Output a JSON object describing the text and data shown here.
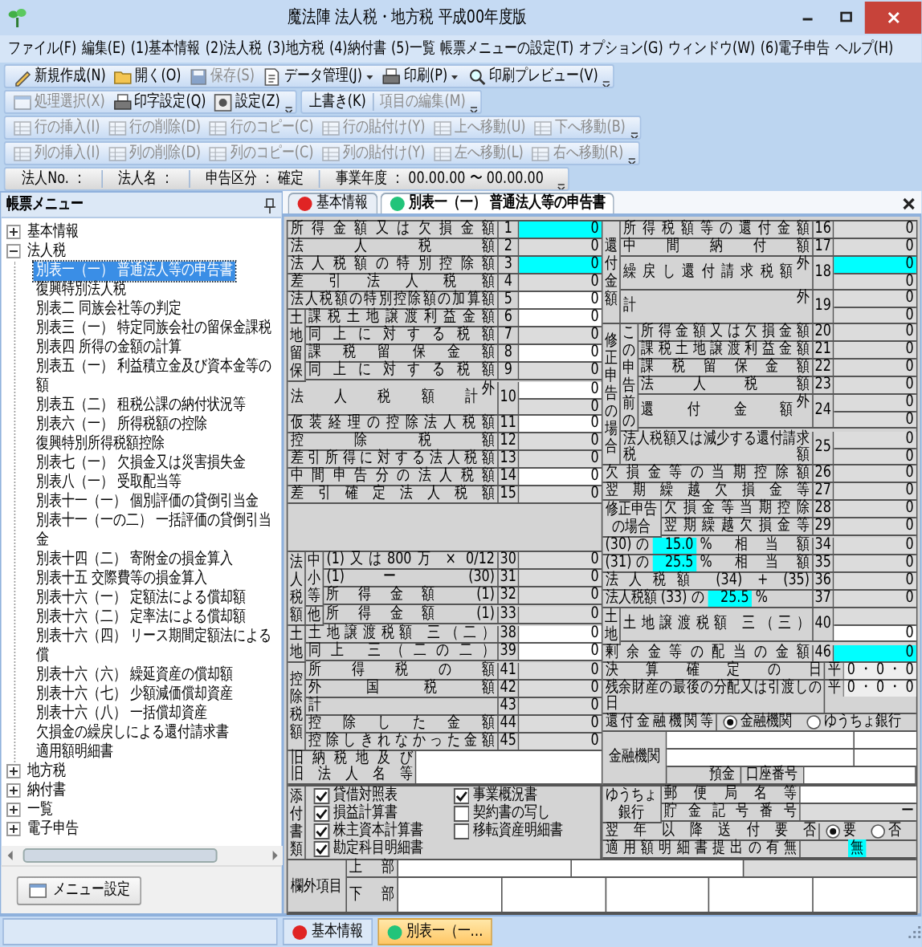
{
  "window": {
    "title": "魔法陣 法人税・地方税 平成00年度版"
  },
  "menu": [
    "ファイル(F)",
    "編集(E)",
    "(1)基本情報",
    "(2)法人税",
    "(3)地方税",
    "(4)納付書",
    "(5)一覧",
    "帳票メニューの設定(T)",
    "オプション(G)",
    "ウィンドウ(W)",
    "(6)電子申告",
    "ヘルプ(H)"
  ],
  "toolbar_rows": [
    [
      [
        {
          "label": "新規作成(N)",
          "kind": "icon-button",
          "disabled": false,
          "dropdown": false
        },
        {
          "label": "開く(O)",
          "kind": "icon-button",
          "disabled": false,
          "dropdown": false
        },
        {
          "label": "保存(S)",
          "kind": "icon-button",
          "disabled": true,
          "dropdown": false
        },
        {
          "label": "データ管理(J)",
          "kind": "icon-button",
          "disabled": false,
          "dropdown": true
        },
        {
          "label": "印刷(P)",
          "kind": "icon-button",
          "disabled": false,
          "dropdown": true
        },
        {
          "label": "印刷プレビュー(V)",
          "kind": "icon-button",
          "disabled": false,
          "dropdown": false
        }
      ]
    ],
    [
      [
        {
          "label": "処理選択(X)",
          "kind": "icon-button",
          "disabled": true,
          "dropdown": false
        },
        {
          "label": "印字設定(Q)",
          "kind": "icon-button",
          "disabled": false,
          "dropdown": false
        },
        {
          "label": "設定(Z)",
          "kind": "icon-button",
          "disabled": false,
          "dropdown": false
        }
      ],
      [
        {
          "label": "上書き(K)",
          "kind": "text-button",
          "disabled": false,
          "dropdown": false
        },
        {
          "label": "項目の編集(M)",
          "kind": "text-button",
          "disabled": true,
          "dropdown": false
        }
      ]
    ],
    [
      [
        {
          "label": "行の挿入(I)",
          "kind": "icon-button",
          "disabled": true,
          "dropdown": false
        },
        {
          "label": "行の削除(D)",
          "kind": "icon-button",
          "disabled": true,
          "dropdown": false
        },
        {
          "label": "行のコピー(C)",
          "kind": "icon-button",
          "disabled": true,
          "dropdown": false
        },
        {
          "label": "行の貼付け(Y)",
          "kind": "icon-button",
          "disabled": true,
          "dropdown": false
        },
        {
          "label": "上へ移動(U)",
          "kind": "icon-button",
          "disabled": true,
          "dropdown": false
        },
        {
          "label": "下へ移動(B)",
          "kind": "icon-button",
          "disabled": true,
          "dropdown": false
        }
      ]
    ],
    [
      [
        {
          "label": "列の挿入(I)",
          "kind": "icon-button",
          "disabled": true,
          "dropdown": false
        },
        {
          "label": "列の削除(D)",
          "kind": "icon-button",
          "disabled": true,
          "dropdown": false
        },
        {
          "label": "列のコピー(C)",
          "kind": "icon-button",
          "disabled": true,
          "dropdown": false
        },
        {
          "label": "列の貼付け(Y)",
          "kind": "icon-button",
          "disabled": true,
          "dropdown": false
        },
        {
          "label": "左へ移動(L)",
          "kind": "icon-button",
          "disabled": true,
          "dropdown": false
        },
        {
          "label": "右へ移動(R)",
          "kind": "icon-button",
          "disabled": true,
          "dropdown": false
        }
      ]
    ]
  ],
  "info_bar": [
    "法人No. ：",
    "法人名 ：",
    "申告区分 ： 確定",
    "事業年度 ： 00.00.00 〜 00.00.00"
  ],
  "sidebar": {
    "title": "帳票メニュー",
    "items": [
      {
        "label": "基本情報",
        "expanded": false,
        "selected": false
      },
      {
        "label": "法人税",
        "expanded": true,
        "selected": false,
        "children": [
          {
            "label": "別表一（一） 普通法人等の申告書",
            "selected": true
          },
          {
            "label": "復興特別法人税",
            "selected": false
          },
          {
            "label": "別表二 同族会社等の判定",
            "selected": false
          },
          {
            "label": "別表三（一） 特定同族会社の留保金課税",
            "selected": false
          },
          {
            "label": "別表四 所得の金額の計算",
            "selected": false
          },
          {
            "label": "別表五（一） 利益積立金及び資本金等の額",
            "selected": false
          },
          {
            "label": "別表五（二） 租税公課の納付状況等",
            "selected": false
          },
          {
            "label": "別表六（一） 所得税額の控除",
            "selected": false
          },
          {
            "label": "復興特別所得税額控除",
            "selected": false
          },
          {
            "label": "別表七（一） 欠損金又は災害損失金",
            "selected": false
          },
          {
            "label": "別表八（一） 受取配当等",
            "selected": false
          },
          {
            "label": "別表十一（一） 個別評価の貸倒引当金",
            "selected": false
          },
          {
            "label": "別表十一（一の二） 一括評価の貸倒引当金",
            "selected": false
          },
          {
            "label": "別表十四（二） 寄附金の損金算入",
            "selected": false
          },
          {
            "label": "別表十五 交際費等の損金算入",
            "selected": false
          },
          {
            "label": "別表十六（一） 定額法による償却額",
            "selected": false
          },
          {
            "label": "別表十六（二） 定率法による償却額",
            "selected": false
          },
          {
            "label": "別表十六（四） リース期間定額法による償",
            "selected": false
          },
          {
            "label": "別表十六（六） 繰延資産の償却額",
            "selected": false
          },
          {
            "label": "別表十六（七） 少額減価償却資産",
            "selected": false
          },
          {
            "label": "別表十六（八） 一括償却資産",
            "selected": false
          },
          {
            "label": "欠損金の繰戻しによる還付請求書",
            "selected": false
          },
          {
            "label": "適用額明細書",
            "selected": false
          }
        ]
      },
      {
        "label": "地方税",
        "expanded": false,
        "selected": false
      },
      {
        "label": "納付書",
        "expanded": false,
        "selected": false
      },
      {
        "label": "一覧",
        "expanded": false,
        "selected": false
      },
      {
        "label": "電子申告",
        "expanded": false,
        "selected": false
      }
    ],
    "button": "メニュー設定"
  },
  "doc_tabs": [
    {
      "label": "基本情報",
      "color": "#e02424",
      "selected": false
    },
    {
      "label": "別表一（一） 普通法人等の申告書",
      "color": "#22c47a",
      "selected": true
    }
  ],
  "form": {
    "left": [
      {
        "kind": "plain",
        "rows": [
          {
            "kind": "amount",
            "label": "所得金額又は欠損金額",
            "no": "1",
            "cells": [
              {
                "kind": "highlight",
                "text": "0"
              }
            ]
          },
          {
            "kind": "amount",
            "label": "法人税額",
            "no": "2",
            "cells": [
              {
                "kind": "calc",
                "text": "0"
              }
            ]
          },
          {
            "kind": "amount",
            "label": "法人税額の特別控除額",
            "no": "3",
            "cells": [
              {
                "kind": "highlight",
                "text": "0"
              }
            ]
          },
          {
            "kind": "amount",
            "label": "差引法人税額",
            "no": "4",
            "cells": [
              {
                "kind": "calc",
                "text": "0"
              }
            ]
          },
          {
            "kind": "amount",
            "label": "法人税額の特別控除額の加算額",
            "no": "5",
            "cells": [
              {
                "kind": "input",
                "text": "0"
              }
            ]
          }
        ]
      },
      {
        "kind": "side",
        "side": "土地留保",
        "rows": [
          {
            "kind": "amount",
            "label": "課税土地譲渡利益金額",
            "no": "6",
            "cells": [
              {
                "kind": "input",
                "text": "0"
              }
            ]
          },
          {
            "kind": "amount",
            "label": "同上に対する税額",
            "no": "7",
            "cells": [
              {
                "kind": "calc",
                "text": "0"
              }
            ]
          },
          {
            "kind": "amount",
            "label": "課税留保金額",
            "no": "8",
            "cells": [
              {
                "kind": "input",
                "text": "0"
              }
            ]
          },
          {
            "kind": "amount",
            "label": "同上に対する税額",
            "no": "9",
            "cells": [
              {
                "kind": "calc",
                "text": "0"
              }
            ]
          }
        ]
      },
      {
        "kind": "plain",
        "rows": [
          {
            "kind": "amount",
            "label": "法人税額計",
            "ext": "外",
            "no": "10",
            "cells": [
              {
                "kind": "input",
                "text": "0"
              },
              {
                "kind": "calc",
                "text": "0"
              }
            ]
          },
          {
            "kind": "amount",
            "label": "仮装経理の控除法人税額",
            "no": "11",
            "cells": [
              {
                "kind": "input",
                "text": "0"
              }
            ]
          },
          {
            "kind": "amount",
            "label": "控除税額",
            "no": "12",
            "cells": [
              {
                "kind": "calc",
                "text": "0"
              }
            ]
          },
          {
            "kind": "amount",
            "label": "差引所得に対する法人税額",
            "no": "13",
            "cells": [
              {
                "kind": "calc",
                "text": "0"
              }
            ]
          },
          {
            "kind": "amount",
            "label": "中間申告分の法人税額",
            "no": "14",
            "cells": [
              {
                "kind": "input",
                "text": "0"
              }
            ]
          },
          {
            "kind": "amount",
            "label": "差引確定法人税額",
            "no": "15",
            "cells": [
              {
                "kind": "calc",
                "text": "0"
              }
            ]
          }
        ]
      },
      {
        "kind": "blank"
      },
      {
        "kind": "side",
        "side": "法人税額",
        "groups": [
          {
            "kind": "side",
            "side": "中小等",
            "rows": [
              {
                "kind": "amount",
                "label": "(1)又は800万 × 0/12",
                "no": "30",
                "cells": [
                  {
                    "kind": "calc",
                    "text": "0"
                  }
                ]
              },
              {
                "kind": "amount",
                "label": "(1) ー (30)",
                "no": "31",
                "cells": [
                  {
                    "kind": "calc",
                    "text": "0"
                  }
                ]
              },
              {
                "kind": "amount",
                "label": "所得金額 (1)",
                "no": "32",
                "cells": [
                  {
                    "kind": "calc",
                    "text": "0"
                  }
                ]
              }
            ]
          },
          {
            "kind": "side",
            "side": "他",
            "rows": [
              {
                "kind": "amount",
                "label": "所得金額 (1)",
                "no": "33",
                "cells": [
                  {
                    "kind": "calc",
                    "text": "0"
                  }
                ]
              }
            ]
          }
        ]
      },
      {
        "kind": "side",
        "side": "土地",
        "rows": [
          {
            "kind": "amount",
            "label": "土地譲渡税額 三（二）",
            "no": "38",
            "cells": [
              {
                "kind": "input",
                "text": "0"
              }
            ]
          },
          {
            "kind": "amount",
            "label": "同上 三（二の二）",
            "no": "39",
            "cells": [
              {
                "kind": "input",
                "text": "0"
              }
            ]
          }
        ]
      },
      {
        "kind": "side",
        "side": "控除税額",
        "rows": [
          {
            "kind": "amount",
            "label": "所得税の額",
            "no": "41",
            "cells": [
              {
                "kind": "calc",
                "text": "0"
              }
            ]
          },
          {
            "kind": "amount",
            "label": "外国税額",
            "no": "42",
            "cells": [
              {
                "kind": "calc",
                "text": "0"
              }
            ]
          },
          {
            "kind": "amount",
            "label": "計",
            "no": "43",
            "cells": [
              {
                "kind": "calc",
                "text": "0"
              }
            ]
          },
          {
            "kind": "amount",
            "label": "控除した金額",
            "no": "44",
            "cells": [
              {
                "kind": "calc",
                "text": "0"
              }
            ]
          },
          {
            "kind": "amount",
            "label": "控除しきれなかった金額",
            "no": "45",
            "cells": [
              {
                "kind": "calc",
                "text": "0"
              }
            ]
          }
        ]
      },
      {
        "kind": "former",
        "lines": [
          "旧納税地及び",
          "旧法人名等"
        ],
        "cell": {
          "kind": "input"
        }
      }
    ],
    "right": [
      {
        "kind": "side",
        "side": "還付金額",
        "rows": [
          {
            "kind": "amount",
            "label": "所得税額等の還付金額",
            "no": "16",
            "cells": [
              {
                "kind": "calc",
                "text": "0"
              }
            ]
          },
          {
            "kind": "amount",
            "label": "中間納付額",
            "no": "17",
            "cells": [
              {
                "kind": "calc",
                "text": "0"
              }
            ]
          },
          {
            "kind": "amount",
            "label": "繰戻し還付請求税額",
            "ext": "外",
            "no": "18",
            "cells": [
              {
                "kind": "highlight",
                "text": "0"
              },
              {
                "kind": "calc",
                "text": "0"
              }
            ]
          },
          {
            "kind": "amount",
            "label": "計",
            "ext": "外",
            "no": "19",
            "cells": [
              {
                "kind": "calc",
                "text": "0"
              },
              {
                "kind": "calc",
                "text": "0"
              }
            ]
          }
        ]
      },
      {
        "kind": "side",
        "side": "修正申告の場合",
        "groups": [
          {
            "kind": "side",
            "side": "この申告前の",
            "rows": [
              {
                "kind": "amount",
                "label": "所得金額又は欠損金額",
                "no": "20",
                "cells": [
                  {
                    "kind": "calc",
                    "text": "0"
                  }
                ]
              },
              {
                "kind": "amount",
                "label": "課税土地譲渡利益金額",
                "no": "21",
                "cells": [
                  {
                    "kind": "calc",
                    "text": "0"
                  }
                ]
              },
              {
                "kind": "amount",
                "label": "課税留保金額",
                "no": "22",
                "cells": [
                  {
                    "kind": "calc",
                    "text": "0"
                  }
                ]
              },
              {
                "kind": "amount",
                "label": "法人税額",
                "no": "23",
                "cells": [
                  {
                    "kind": "calc",
                    "text": "0"
                  }
                ]
              },
              {
                "kind": "amount",
                "label": "還付金額",
                "ext": "外",
                "no": "24",
                "cells": [
                  {
                    "kind": "calc",
                    "text": "0"
                  },
                  {
                    "kind": "calc",
                    "text": "0"
                  }
                ]
              }
            ]
          },
          {
            "kind": "plain",
            "rows": [
              {
                "kind": "amount",
                "label": "法人税額又は減少する還付請求税額",
                "no": "25",
                "cells": [
                  {
                    "kind": "calc",
                    "text": "0"
                  },
                  {
                    "kind": "calc",
                    "text": "0"
                  }
                ]
              }
            ]
          }
        ]
      },
      {
        "kind": "plain",
        "rows": [
          {
            "kind": "amount",
            "label": "欠損金等の当期控除額",
            "no": "26",
            "cells": [
              {
                "kind": "calc",
                "text": "0"
              }
            ]
          },
          {
            "kind": "amount",
            "label": "翌期繰越欠損金等",
            "no": "27",
            "cells": [
              {
                "kind": "calc",
                "text": "0"
              }
            ]
          }
        ]
      },
      {
        "kind": "wide-side",
        "side": "修正申告の場合",
        "rows": [
          {
            "kind": "amount",
            "label": "欠損金等当期控除",
            "no": "28",
            "cells": [
              {
                "kind": "calc",
                "text": "0"
              }
            ]
          },
          {
            "kind": "amount",
            "label": "翌期繰越欠損金等",
            "no": "29",
            "cells": [
              {
                "kind": "calc",
                "text": "0"
              }
            ]
          }
        ]
      },
      {
        "kind": "plain",
        "rows": [
          {
            "kind": "amount",
            "parts": [
              {
                "kind": "text",
                "text": "(30) の"
              },
              {
                "kind": "highlight",
                "text": "15.0"
              },
              {
                "kind": "text",
                "text": "% 相当額"
              }
            ],
            "no": "34",
            "cells": [
              {
                "kind": "calc",
                "text": "0"
              }
            ]
          },
          {
            "kind": "amount",
            "parts": [
              {
                "kind": "text",
                "text": "(31) の"
              },
              {
                "kind": "highlight",
                "text": "25.5"
              },
              {
                "kind": "text",
                "text": "% 相当額"
              }
            ],
            "no": "35",
            "cells": [
              {
                "kind": "calc",
                "text": "0"
              }
            ]
          },
          {
            "kind": "amount",
            "label": "法人税額 (34) + (35)",
            "no": "36",
            "cells": [
              {
                "kind": "calc",
                "text": "0"
              }
            ]
          },
          {
            "kind": "amount",
            "parts": [
              {
                "kind": "text",
                "text": "法人税額 (33) の"
              },
              {
                "kind": "highlight",
                "text": "25.5"
              },
              {
                "kind": "text",
                "text": "%"
              }
            ],
            "no": "37",
            "cells": [
              {
                "kind": "calc",
                "text": "0"
              }
            ]
          }
        ]
      },
      {
        "kind": "side",
        "side": "土地",
        "rows": [
          {
            "kind": "amount",
            "label": "土地譲渡税額 三（三）",
            "no": "40",
            "cells": [
              {
                "kind": "calc"
              },
              {
                "kind": "input",
                "text": "0"
              }
            ]
          }
        ]
      },
      {
        "kind": "plain",
        "rows": [
          {
            "kind": "amount",
            "label": "剰余金等の配当の金額",
            "no": "46",
            "cells": [
              {
                "kind": "highlight",
                "text": "0"
              }
            ]
          },
          {
            "kind": "date",
            "label": "決算確定の日",
            "era": "平",
            "text": "0 ・ 0 ・ 0"
          },
          {
            "kind": "date",
            "label": "残余財産の最後の分配又は引渡しの日",
            "era": "平",
            "text": "0 ・ 0 ・ 0"
          },
          {
            "kind": "choice",
            "label": "還付金融機関等",
            "options": [
              {
                "label": "金融機関",
                "selected": true
              },
              {
                "label": "ゆうちょ銀行",
                "selected": false
              }
            ]
          }
        ]
      },
      {
        "kind": "bank",
        "label": "金融機関",
        "lines": [
          [
            {
              "kind": "input"
            },
            {
              "kind": "short-input"
            }
          ],
          [
            {
              "kind": "input"
            },
            {
              "kind": "short-input"
            }
          ],
          [
            {
              "kind": "label",
              "text": "預金"
            },
            {
              "kind": "label",
              "text": "口座番号"
            },
            {
              "kind": "input"
            }
          ]
        ]
      }
    ],
    "attachments": {
      "side": "添付書類",
      "items": [
        {
          "label": "貸借対照表",
          "checked": true
        },
        {
          "label": "事業概況書",
          "checked": true
        },
        {
          "label": "損益計算書",
          "checked": true
        },
        {
          "label": "契約書の写し",
          "checked": false
        },
        {
          "label": "株主資本計算書",
          "checked": true
        },
        {
          "label": "移転資産明細書",
          "checked": false
        },
        {
          "label": "勘定科目明細書",
          "checked": true
        }
      ]
    },
    "bottom_right": [
      {
        "kind": "wide-side",
        "side": "ゆうちょ銀行",
        "rows": [
          {
            "kind": "amount",
            "label": "郵便局名等",
            "cells": [
              {
                "kind": "input"
              }
            ]
          },
          {
            "kind": "amount",
            "label": "貯金記号番号",
            "cells": [
              {
                "kind": "calc",
                "text": "ー"
              }
            ]
          }
        ]
      },
      {
        "kind": "plain",
        "rows": [
          {
            "kind": "choice",
            "label": "翌年以降送付要否",
            "options": [
              {
                "label": "要",
                "selected": true
              },
              {
                "label": "否",
                "selected": false
              }
            ]
          },
          {
            "kind": "amount",
            "label": "適用額明細書提出の有無",
            "cells": [
              {
                "kind": "flag",
                "text": "無"
              }
            ]
          }
        ]
      }
    ],
    "margin_items": {
      "kind": "wide-side",
      "side": "欄外項目",
      "rows": [
        {
          "kind": "inline",
          "label": "上部",
          "cells": [
            {
              "kind": "input"
            },
            {
              "kind": "input"
            },
            {
              "kind": "calc"
            }
          ]
        },
        {
          "kind": "inline",
          "label": "下部",
          "cells": [
            {
              "kind": "input"
            },
            {
              "kind": "input"
            },
            {
              "kind": "input"
            },
            {
              "kind": "input"
            },
            {
              "kind": "input"
            }
          ]
        }
      ]
    }
  },
  "taskbar_tabs": [
    {
      "label": "基本情報",
      "color": "#e02424",
      "selected": false
    },
    {
      "label": "別表一（一…",
      "color": "#22c47a",
      "selected": true
    }
  ]
}
